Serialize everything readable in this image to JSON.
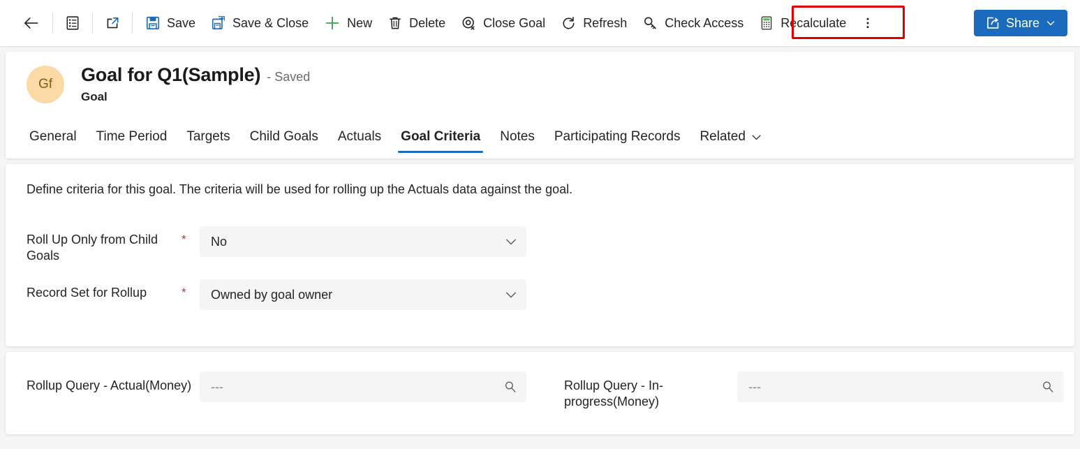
{
  "commandbar": {
    "back": {
      "label": "",
      "icon": "back-arrow-icon"
    },
    "form_selector": {
      "label": "",
      "icon": "form-list-icon"
    },
    "popout": {
      "label": "",
      "icon": "pop-out-icon"
    },
    "save": {
      "label": "Save",
      "icon": "save-icon"
    },
    "save_close": {
      "label": "Save & Close",
      "icon": "save-and-close-icon"
    },
    "new": {
      "label": "New",
      "icon": "plus-icon"
    },
    "delete": {
      "label": "Delete",
      "icon": "trash-icon"
    },
    "close_goal": {
      "label": "Close Goal",
      "icon": "close-goal-target-icon"
    },
    "refresh": {
      "label": "Refresh",
      "icon": "refresh-icon"
    },
    "check_access": {
      "label": "Check Access",
      "icon": "key-icon"
    },
    "recalculate": {
      "label": "Recalculate",
      "icon": "calculator-icon",
      "highlighted": true
    },
    "overflow": {
      "label": "",
      "icon": "more-vertical-icon"
    },
    "share": {
      "label": "Share",
      "icon": "share-icon",
      "color": "#1a6bbd"
    }
  },
  "record": {
    "avatar_initials": "Gf",
    "title": "Goal for Q1(Sample)",
    "save_state": "- Saved",
    "entity": "Goal",
    "avatar_color": "#fbd9a5"
  },
  "tabs": [
    {
      "label": "General",
      "active": false
    },
    {
      "label": "Time Period",
      "active": false
    },
    {
      "label": "Targets",
      "active": false
    },
    {
      "label": "Child Goals",
      "active": false
    },
    {
      "label": "Actuals",
      "active": false
    },
    {
      "label": "Goal Criteria",
      "active": true
    },
    {
      "label": "Notes",
      "active": false
    },
    {
      "label": "Participating Records",
      "active": false
    },
    {
      "label": "Related",
      "active": false,
      "has_chevron": true
    }
  ],
  "criteria": {
    "description": "Define criteria for this goal. The criteria will be used for rolling up the Actuals data against the goal.",
    "required_marker": "*",
    "fields": [
      {
        "label": "Roll Up Only from Child Goals",
        "value": "No",
        "required": true
      },
      {
        "label": "Record Set for Rollup",
        "value": "Owned by goal owner",
        "required": true
      }
    ]
  },
  "rollup": {
    "fields": [
      {
        "label": "Rollup Query - Actual(Money)",
        "value": "---"
      },
      {
        "label": "Rollup Query - In-progress(Money)",
        "value": "---"
      }
    ]
  }
}
